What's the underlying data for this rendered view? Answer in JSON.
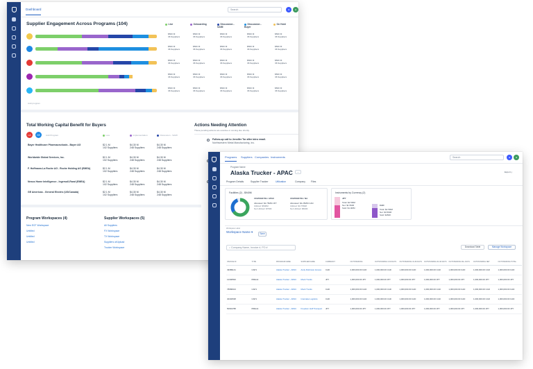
{
  "colors": {
    "rail": "#1e3f7c",
    "link": "#1f6fd1",
    "live": "#7dcf6a",
    "onboarding": "#9966cc",
    "discussion_sami": "#2546a8",
    "discussion_buyer": "#1e8fe0",
    "on_hold": "#f2c257"
  },
  "dashboard": {
    "tab": "Dashboard",
    "search_placeholder": "Search",
    "engagement_title": "Supplier Engagement Across Programs (104)",
    "legend": [
      "Live",
      "Onboarding",
      "Discussion - SAMI",
      "Discussion - Buyer",
      "On Hold"
    ],
    "rows": [
      {
        "circle": "#f2c94c",
        "segments": [
          0.38,
          0.22,
          0.2,
          0.13,
          0.07
        ]
      },
      {
        "circle": "#1e88e5",
        "segments": [
          0.18,
          0.25,
          0.09,
          0.41,
          0.07
        ]
      },
      {
        "circle": "#e53935",
        "segments": [
          0.38,
          0.26,
          0.15,
          0.14,
          0.07
        ]
      },
      {
        "circle": "#9c27b0",
        "segments": [
          0.6,
          0.09,
          0.04,
          0.04,
          0.03
        ]
      },
      {
        "circle": "#29b6f6",
        "segments": [
          0.52,
          0.3,
          0.09,
          0.05,
          0.04
        ]
      }
    ],
    "cell_amount": "$500 M",
    "cell_suppliers": "36 Suppliers",
    "add_program": "Add program",
    "wc_title": "Total Working Capital Benefit for Buyers",
    "wc_add": "Add Program",
    "wc_cols": [
      "Live",
      "Implementation",
      "Discussion - SAMI"
    ],
    "wc_rows": [
      {
        "name": "Bayer Healthcare Pharmaceuticals - Bayer AG",
        "v": [
          "$2.1 M",
          "$4.30 M",
          "$4.30 M"
        ],
        "s": [
          "102 Suppliers",
          "248 Suppliers",
          "248 Suppliers"
        ]
      },
      {
        "name": "Worldwide Global Services, Inc.",
        "v": [
          "$2.1 M",
          "$4.30 M",
          "$4.30 M"
        ],
        "s": [
          "102 Suppliers",
          "248 Suppliers",
          "248 Suppliers"
        ]
      },
      {
        "name": "F. Hoffmann-La Roche AG - Roche Holding AG (EMEA)",
        "v": [
          "$2.1 M",
          "$4.30 M",
          "$4.30 M"
        ],
        "s": [
          "102 Suppliers",
          "248 Suppliers",
          "248 Suppliers"
        ]
      },
      {
        "name": "Nexus Home Intelligence - Ingersoll-Rand (EMEA)",
        "v": [
          "$2.1 M",
          "$4.30 M",
          "$4.30 M"
        ],
        "s": [
          "102 Suppliers",
          "248 Suppliers",
          "248 Suppliers"
        ]
      },
      {
        "name": "GE Americas - General Electric (US/Canada)",
        "v": [
          "$2.1 M",
          "$4.30 M",
          "$4.30 M"
        ],
        "s": [
          "102 Suppliers",
          "248 Suppliers",
          "248 Suppliers"
        ]
      }
    ],
    "actions_title": "Actions Needing Attention",
    "actions_sub": "These pending actions are overdue or coming due shortly.",
    "actions": [
      {
        "title": "Follow-up call to Jennifer Tor after intro email.",
        "sub": "Northwestern Metal Manufacturing, Inc."
      },
      {
        "title": "Send",
        "sub": "F. Ho"
      },
      {
        "title": "Prep",
        "sub": "Nexu"
      }
    ],
    "pw_title": "Program Workspaces (4)",
    "pw_items": [
      "New ECF Workspace",
      "Untitled",
      "Untitled",
      "Untitled"
    ],
    "sw_title": "Supplier Workspaces (5)",
    "sw_items": [
      "All Suppliers",
      "FX Workspace",
      "TX Workspace",
      "Suppliers w/Upload",
      "Trucker Workspace"
    ]
  },
  "program": {
    "nav": [
      "Programs",
      "Suppliers",
      "Companies",
      "Instruments"
    ],
    "search_placeholder": "Search",
    "label": "Program Name",
    "title": "Alaska Trucker - APAC",
    "more": "...",
    "export": "Export",
    "tabs": [
      "Program Details",
      "Supplier Tracker",
      "Utilization",
      "Company",
      "Files"
    ],
    "facilities_title": "Facilities (2) - $940M",
    "facility_a": {
      "id": "#102539470b / APAC",
      "lines": [
        "Allocated: $2.75MM JPY",
        "Utilized: $500M",
        "Not Utilized: $750K"
      ]
    },
    "facility_b": {
      "id": "#102539470b / NA",
      "lines": [
        "Allocated: $4.25MM CAD",
        "Utilized: $3.75MM",
        "Not Utilized: $500K"
      ]
    },
    "instr_title": "Instruments by Currency (2)",
    "jpy": {
      "cur": "JPY",
      "lines": [
        "Total: $2.5MM",
        "Net: $1.5MM",
        "Sold: $1.0MM"
      ]
    },
    "cad": {
      "cur": "CAD",
      "lines": [
        "Total: $2.5MM",
        "Net: $3.5MM",
        "Sold: $450K"
      ]
    },
    "ws_label": "Workspace Label",
    "ws_name": "Workspace Name",
    "save": "Save",
    "filter_placeholder": "Company Name, Invoice #, PO #",
    "download": "Download Table",
    "manage": "Manage Workspace",
    "columns": [
      "INVOICE ID",
      "TYPE",
      "PROGRAM NAME",
      "SUPPLIER NAME",
      "CURRENCY",
      "OUTSTANDING",
      "OUTSTANDING 0-30 DAYS",
      "OUTSTANDING 31-60 DAYS",
      "OUTSTANDING 61-90 DAYS",
      "OUTSTANDING 90+ DAYS",
      "OUTSTANDING NET",
      "OUTSTANDING TOTAL"
    ],
    "rows": [
      [
        "49389141",
        "CAP1",
        "Alaska Trucker - APAC",
        "Andy Robinson Access",
        "CAD",
        "2,000,000.00 CAD",
        "1,000,000.00 CAD",
        "1,000,000.00 CAD",
        "1,000,000.00 CAD",
        "1,000,000.00 CAD",
        "1,000,000.00 CAD",
        "1,000,000.00 CAD"
      ],
      [
        "12300593",
        "PREG4",
        "Alaska Trucker - APAC",
        "Mock Trucks",
        "JPY",
        "1,000,000.00 JPY",
        "1,000,000.00 JPY",
        "1,000,000.00 JPY",
        "1,000,000.00 JPY",
        "1,000,000.00 JPY",
        "1,000,000.00 JPY",
        "1,000,000.00 JPY"
      ],
      [
        "78680913",
        "CAP1",
        "Alaska Trucker - APAC",
        "Mock Trucks",
        "CAD",
        "1,000,000.00 CAD",
        "1,000,000.00 CAD",
        "1,000,000.00 CAD",
        "1,000,000.00 CAD",
        "1,000,000.00 CAD",
        "1,000,000.00 CAD",
        "1,000,000.00 CAD"
      ],
      [
        "40440638",
        "CAP1",
        "Alaska Trucker - APAC",
        "Interstate Logistics",
        "CAD",
        "1,000,000.00 CAD",
        "1,000,000.00 CAD",
        "1,000,000.00 CAD",
        "1,000,000.00 CAD",
        "1,000,000.00 CAD",
        "1,000,000.00 CAD",
        "1,000,000.00 CAD"
      ],
      [
        "50991788",
        "PREG4",
        "Alaska Trucker - APAC",
        "Freedom Hoff Transport",
        "JPY",
        "1,000,000.00 JPY",
        "1,000,000.00 JPY",
        "1,000,000.00 JPY",
        "1,000,000.00 JPY",
        "1,000,000.00 JPY",
        "1,000,000.00 JPY",
        "1,000,000.00 JPY"
      ]
    ]
  }
}
